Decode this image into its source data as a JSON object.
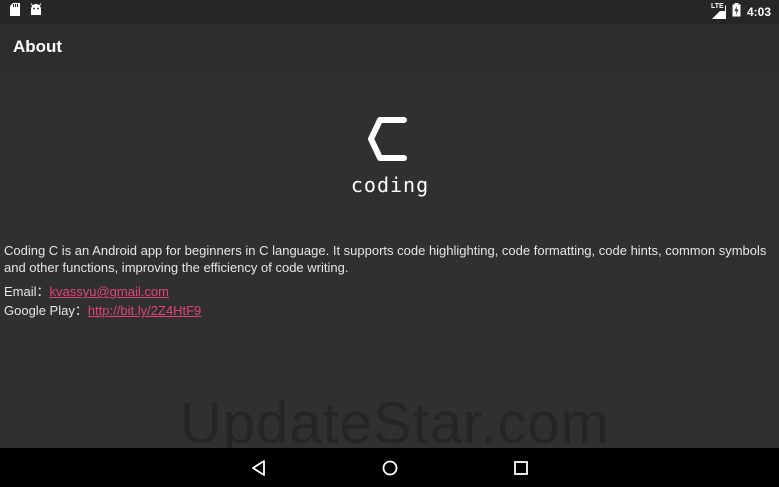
{
  "status_bar": {
    "left_icons": [
      "sd-card-icon",
      "android-icon"
    ],
    "network_label": "LTE",
    "time": "4:03"
  },
  "app_bar": {
    "title": "About"
  },
  "logo": {
    "letter": "C",
    "text": "coding"
  },
  "about": {
    "description": "Coding C is an Android app for beginners in C language. It supports code highlighting, code formatting, code hints, common symbols and other functions, improving the efficiency of code writing.",
    "email_label": "Email：",
    "email_value": "kvassyu@gmail.com",
    "google_play_label": "Google Play：",
    "google_play_value": "http://bit.ly/2Z4HtF9"
  },
  "watermark": "UpdateStar.com",
  "nav_bar": {
    "buttons": [
      "back-icon",
      "home-icon",
      "recents-icon"
    ]
  },
  "colors": {
    "background": "#303030",
    "app_bar": "#2d2d2d",
    "status_bar": "#262626",
    "link": "#e0437a",
    "text": "#e6e6e6"
  }
}
